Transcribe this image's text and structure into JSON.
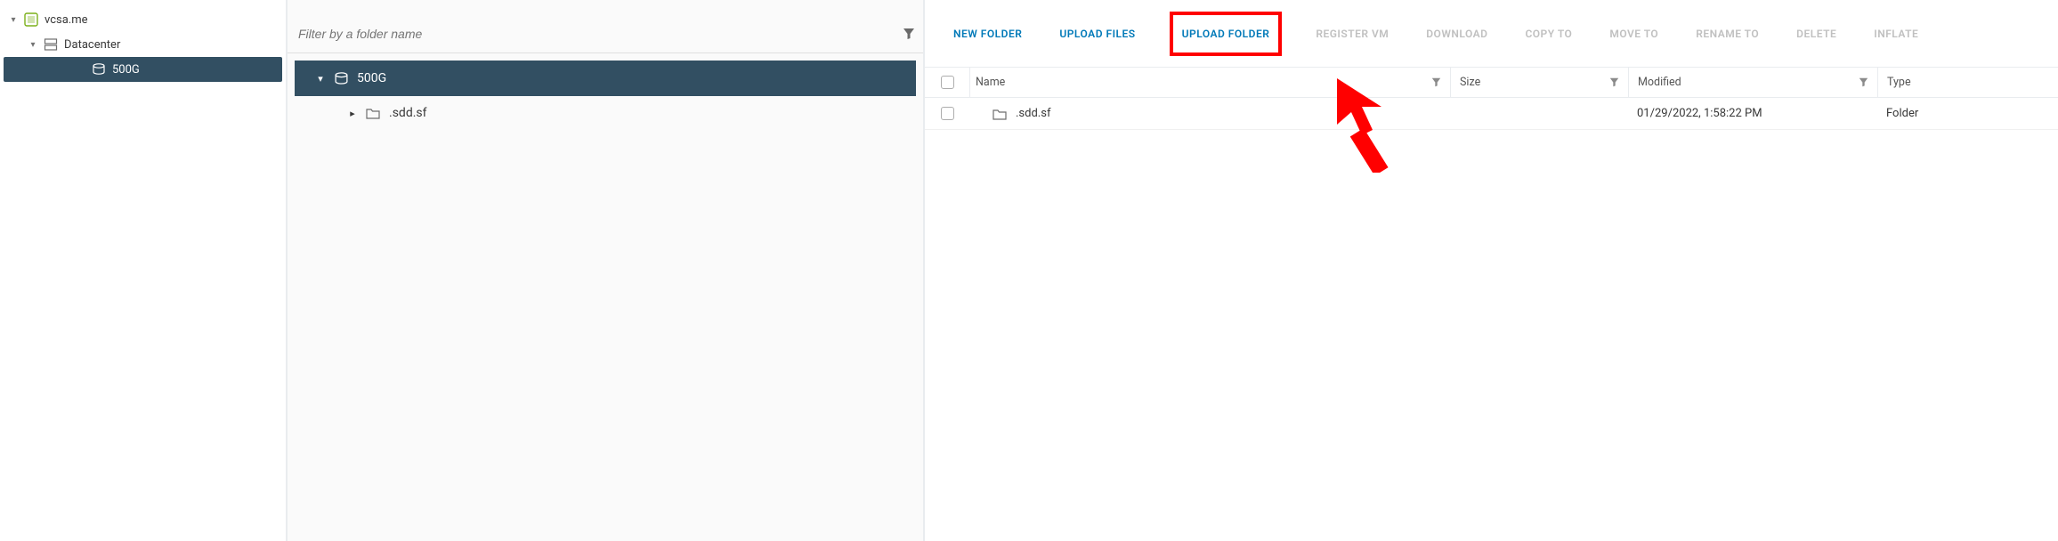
{
  "nav": {
    "root": {
      "label": "vcsa.me"
    },
    "datacenter": {
      "label": "Datacenter"
    },
    "datastore": {
      "label": "500G"
    }
  },
  "mid": {
    "filter_placeholder": "Filter by a folder name",
    "root": {
      "label": "500G"
    },
    "child": {
      "label": ".sdd.sf"
    }
  },
  "toolbar": {
    "new_folder": "NEW FOLDER",
    "upload_files": "UPLOAD FILES",
    "upload_folder": "UPLOAD FOLDER",
    "register_vm": "REGISTER VM",
    "download": "DOWNLOAD",
    "copy_to": "COPY TO",
    "move_to": "MOVE TO",
    "rename_to": "RENAME TO",
    "delete": "DELETE",
    "inflate": "INFLATE"
  },
  "columns": {
    "name": "Name",
    "size": "Size",
    "modified": "Modified",
    "type": "Type"
  },
  "rows": [
    {
      "name": ".sdd.sf",
      "size": "",
      "modified": "01/29/2022, 1:58:22 PM",
      "type": "Folder"
    }
  ]
}
